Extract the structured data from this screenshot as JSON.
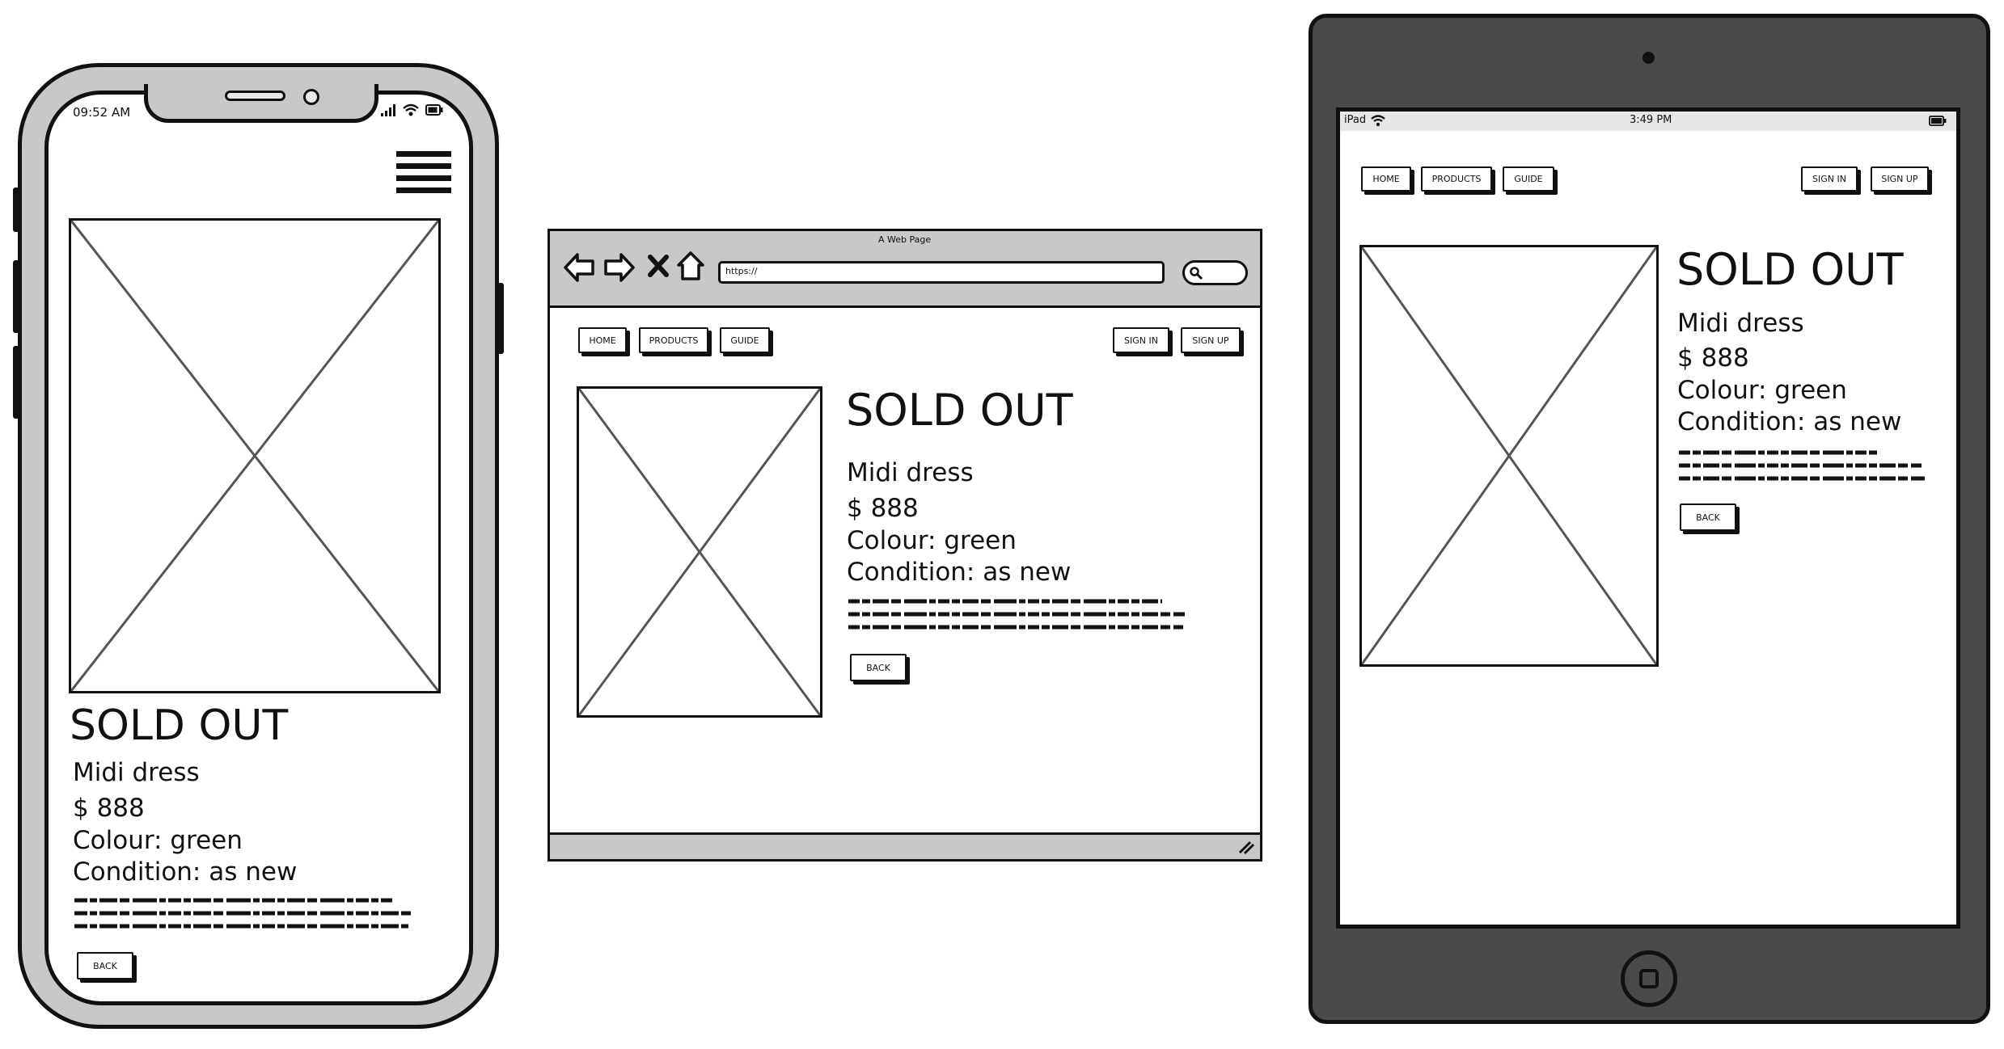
{
  "phone": {
    "status_time": "09:52 AM",
    "title": "SOLD OUT",
    "product_name": "Midi dress",
    "price": "$ 888",
    "colour": "Colour: green",
    "condition": "Condition: as new",
    "back_label": "BACK"
  },
  "browser": {
    "window_title": "A Web Page",
    "url": "https://",
    "nav": {
      "home": "HOME",
      "products": "PRODUCTS",
      "guide": "GUIDE",
      "sign_in": "SIGN IN",
      "sign_up": "SIGN UP"
    },
    "title": "SOLD OUT",
    "product_name": "Midi dress",
    "price": "$ 888",
    "colour": "Colour: green",
    "condition": "Condition: as new",
    "back_label": "BACK"
  },
  "tablet": {
    "device_label": "iPad",
    "status_time": "3:49 PM",
    "nav": {
      "home": "HOME",
      "products": "PRODUCTS",
      "guide": "GUIDE",
      "sign_in": "SIGN IN",
      "sign_up": "SIGN UP"
    },
    "title": "SOLD OUT",
    "product_name": "Midi dress",
    "price": "$ 888",
    "colour": "Colour: green",
    "condition": "Condition: as new",
    "back_label": "BACK"
  },
  "icons": {
    "hamburger": "hamburger-menu-icon",
    "back": "back-arrow-icon",
    "forward": "forward-arrow-icon",
    "stop": "close-icon",
    "home": "home-icon",
    "search": "search-icon",
    "resize": "resize-grip-icon",
    "signal": "signal-icon",
    "wifi": "wifi-icon",
    "battery": "battery-icon"
  },
  "colors": {
    "frame_gray": "#c8c8c8",
    "tablet_body": "#4a4a4a",
    "ink": "#111111"
  }
}
